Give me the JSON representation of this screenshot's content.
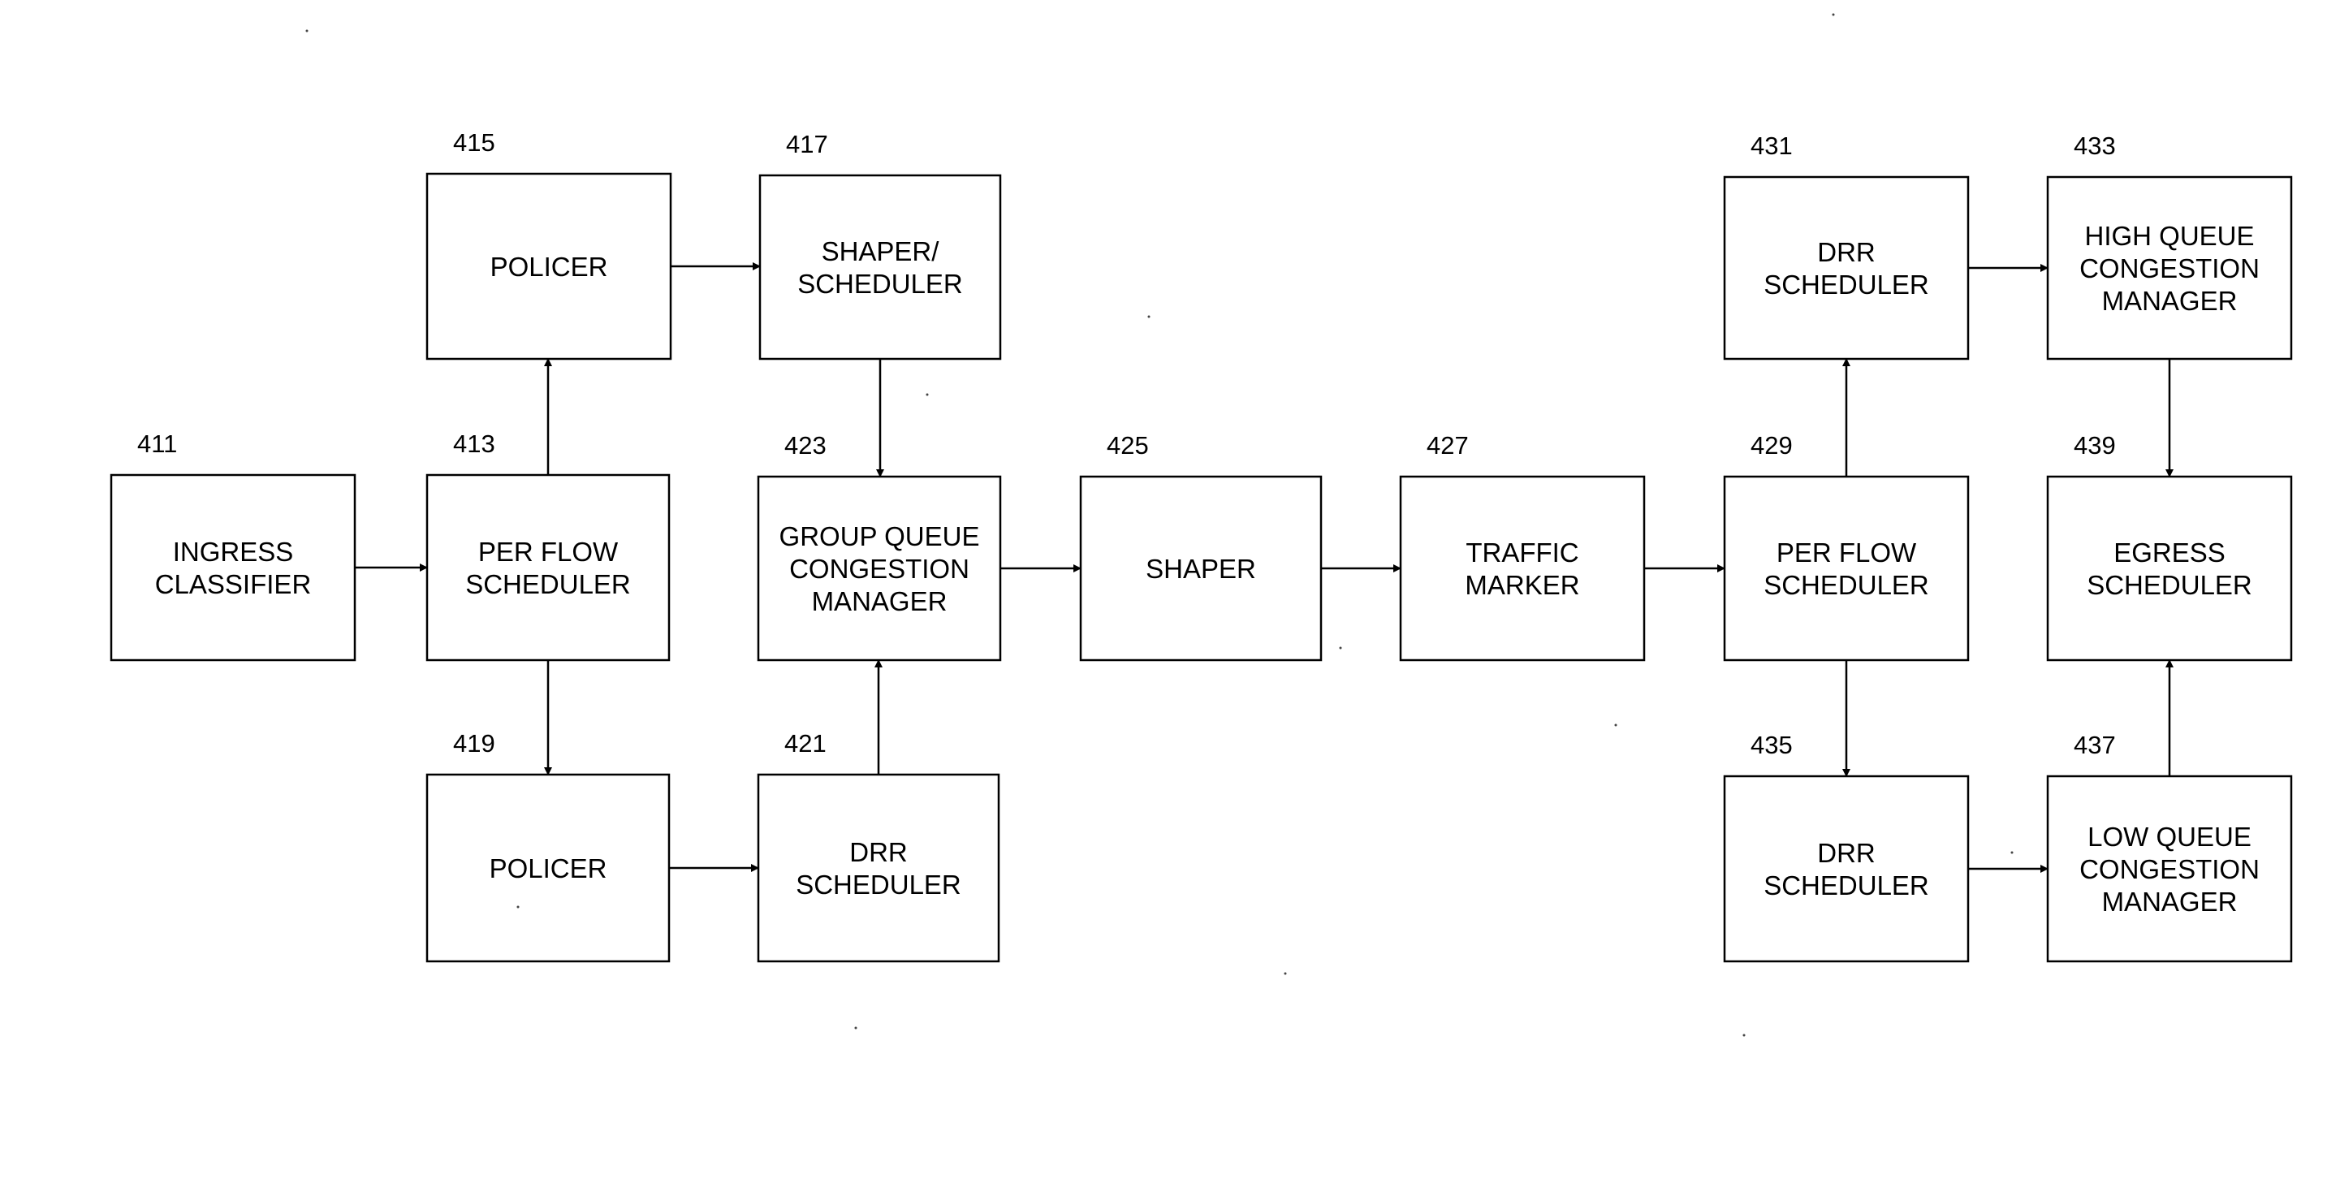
{
  "diagram": {
    "type": "block-flow",
    "nodes": [
      {
        "id": "411",
        "ref": "411",
        "lines": [
          "INGRESS",
          "CLASSIFIER"
        ]
      },
      {
        "id": "413",
        "ref": "413",
        "lines": [
          "PER FLOW",
          "SCHEDULER"
        ]
      },
      {
        "id": "415",
        "ref": "415",
        "lines": [
          "POLICER"
        ]
      },
      {
        "id": "417",
        "ref": "417",
        "lines": [
          "SHAPER/",
          "SCHEDULER"
        ]
      },
      {
        "id": "419",
        "ref": "419",
        "lines": [
          "POLICER"
        ]
      },
      {
        "id": "421",
        "ref": "421",
        "lines": [
          "DRR",
          "SCHEDULER"
        ]
      },
      {
        "id": "423",
        "ref": "423",
        "lines": [
          "GROUP QUEUE",
          "CONGESTION",
          "MANAGER"
        ]
      },
      {
        "id": "425",
        "ref": "425",
        "lines": [
          "SHAPER"
        ]
      },
      {
        "id": "427",
        "ref": "427",
        "lines": [
          "TRAFFIC",
          "MARKER"
        ]
      },
      {
        "id": "429",
        "ref": "429",
        "lines": [
          "PER FLOW",
          "SCHEDULER"
        ]
      },
      {
        "id": "431",
        "ref": "431",
        "lines": [
          "DRR",
          "SCHEDULER"
        ]
      },
      {
        "id": "433",
        "ref": "433",
        "lines": [
          "HIGH QUEUE",
          "CONGESTION",
          "MANAGER"
        ]
      },
      {
        "id": "435",
        "ref": "435",
        "lines": [
          "DRR",
          "SCHEDULER"
        ]
      },
      {
        "id": "437",
        "ref": "437",
        "lines": [
          "LOW QUEUE",
          "CONGESTION",
          "MANAGER"
        ]
      },
      {
        "id": "439",
        "ref": "439",
        "lines": [
          "EGRESS",
          "SCHEDULER"
        ]
      }
    ],
    "edges": [
      {
        "from": "411",
        "to": "413"
      },
      {
        "from": "413",
        "to": "415"
      },
      {
        "from": "413",
        "to": "419"
      },
      {
        "from": "415",
        "to": "417"
      },
      {
        "from": "419",
        "to": "421"
      },
      {
        "from": "417",
        "to": "423"
      },
      {
        "from": "421",
        "to": "423"
      },
      {
        "from": "423",
        "to": "425"
      },
      {
        "from": "425",
        "to": "427"
      },
      {
        "from": "427",
        "to": "429"
      },
      {
        "from": "429",
        "to": "431"
      },
      {
        "from": "429",
        "to": "435"
      },
      {
        "from": "431",
        "to": "433"
      },
      {
        "from": "435",
        "to": "437"
      },
      {
        "from": "433",
        "to": "439"
      },
      {
        "from": "437",
        "to": "439"
      }
    ]
  }
}
